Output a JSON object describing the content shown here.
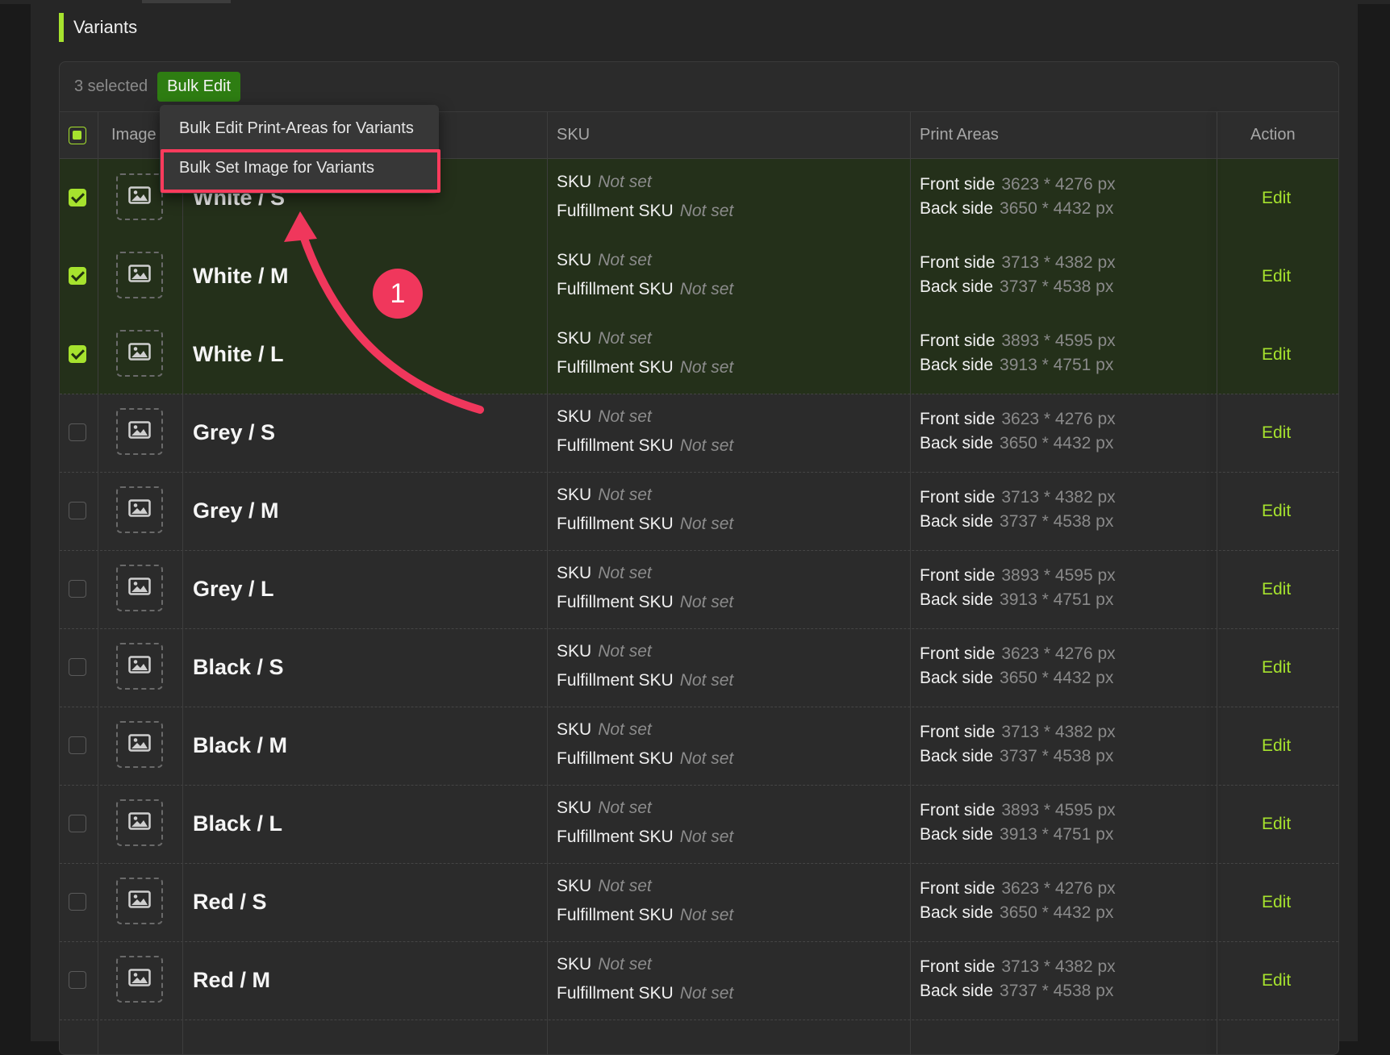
{
  "section": {
    "title": "Variants"
  },
  "bulk": {
    "selected_text": "3 selected",
    "button_label": "Bulk Edit"
  },
  "table": {
    "headers": {
      "image": "Image",
      "sku": "SKU",
      "print_areas": "Print Areas",
      "action": "Action"
    }
  },
  "dropdown": {
    "items": [
      "Bulk Edit Print-Areas for Variants",
      "Bulk Set Image for Variants"
    ]
  },
  "annotation": {
    "step": "1"
  },
  "labels": {
    "sku": "SKU",
    "fulfillment_sku": "Fulfillment SKU",
    "not_set": "Not set",
    "front": "Front side",
    "back": "Back side",
    "edit": "Edit"
  },
  "rows": [
    {
      "name": "White / S",
      "checked": true,
      "front": "3623 * 4276 px",
      "back": "3650 * 4432 px"
    },
    {
      "name": "White / M",
      "checked": true,
      "front": "3713 * 4382 px",
      "back": "3737 * 4538 px"
    },
    {
      "name": "White / L",
      "checked": true,
      "front": "3893 * 4595 px",
      "back": "3913 * 4751 px"
    },
    {
      "name": "Grey / S",
      "checked": false,
      "front": "3623 * 4276 px",
      "back": "3650 * 4432 px"
    },
    {
      "name": "Grey / M",
      "checked": false,
      "front": "3713 * 4382 px",
      "back": "3737 * 4538 px"
    },
    {
      "name": "Grey / L",
      "checked": false,
      "front": "3893 * 4595 px",
      "back": "3913 * 4751 px"
    },
    {
      "name": "Black / S",
      "checked": false,
      "front": "3623 * 4276 px",
      "back": "3650 * 4432 px"
    },
    {
      "name": "Black / M",
      "checked": false,
      "front": "3713 * 4382 px",
      "back": "3737 * 4538 px"
    },
    {
      "name": "Black / L",
      "checked": false,
      "front": "3893 * 4595 px",
      "back": "3913 * 4751 px"
    },
    {
      "name": "Red / S",
      "checked": false,
      "front": "3623 * 4276 px",
      "back": "3650 * 4432 px"
    },
    {
      "name": "Red / M",
      "checked": false,
      "front": "3713 * 4382 px",
      "back": "3737 * 4538 px"
    }
  ],
  "colors": {
    "accent": "#a6e22e",
    "bulk_button": "#2e7d12",
    "annotation": "#f0375c"
  }
}
